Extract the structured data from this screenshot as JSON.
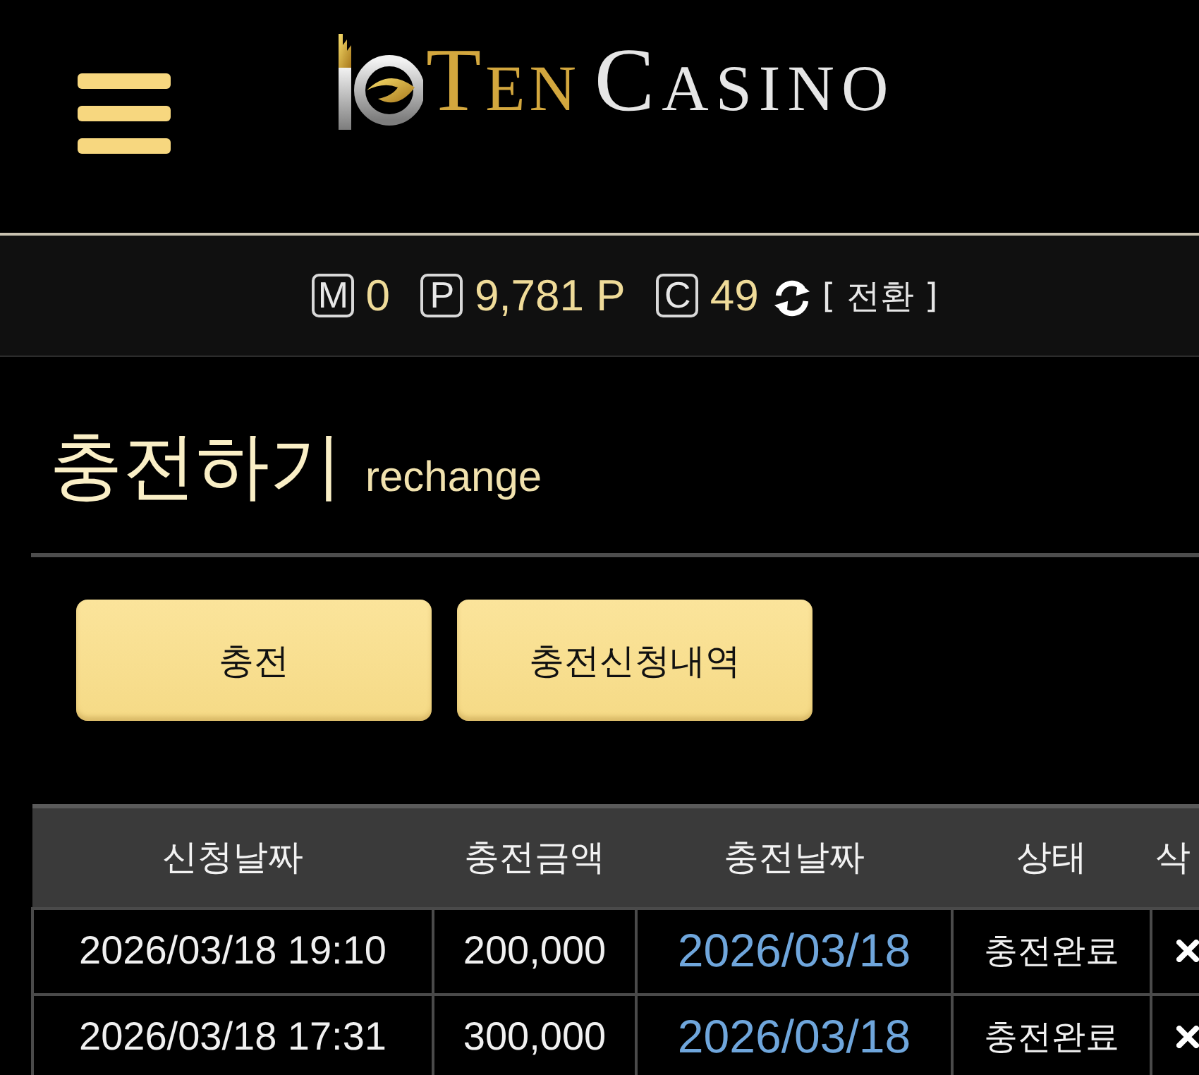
{
  "header": {
    "logo": {
      "word_1": "TEN",
      "word_2": "CASINO"
    }
  },
  "balance_bar": {
    "items": [
      {
        "badge": "M",
        "value": "0"
      },
      {
        "badge": "P",
        "value": "9,781 P"
      },
      {
        "badge": "C",
        "value": "49"
      }
    ],
    "convert_label": "[ 전환 ]"
  },
  "page_title": {
    "title": "충전하기",
    "subtitle": "rechange"
  },
  "buttons": [
    {
      "label": "충전"
    },
    {
      "label": "충전신청내역"
    }
  ],
  "table": {
    "columns": [
      "신청날짜",
      "충전금액",
      "충전날짜",
      "상태",
      "삭"
    ],
    "rows": [
      {
        "requested": "2026/03/18 19:10",
        "amount": "200,000",
        "charged": "2026/03/18",
        "status": "충전완료"
      },
      {
        "requested": "2026/03/18 17:31",
        "amount": "300,000",
        "charged": "2026/03/18",
        "status": "충전완료"
      }
    ]
  }
}
